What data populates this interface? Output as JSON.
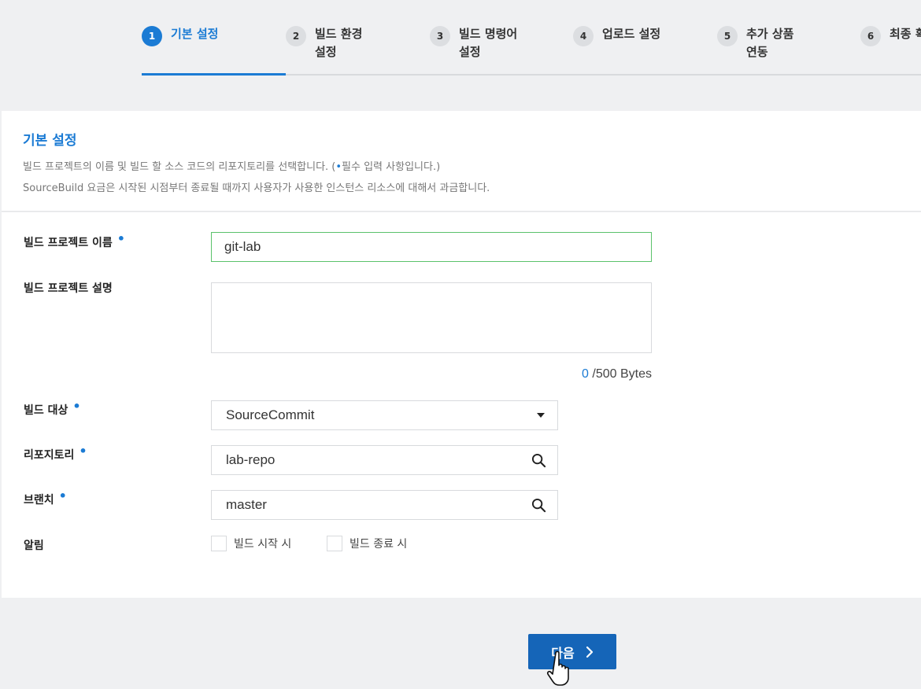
{
  "stepper": {
    "steps": [
      {
        "num": "1",
        "label": "기본 설정",
        "active": true
      },
      {
        "num": "2",
        "label": "빌드 환경\n설정",
        "active": false
      },
      {
        "num": "3",
        "label": "빌드 명령어\n설정",
        "active": false
      },
      {
        "num": "4",
        "label": "업로드 설정",
        "active": false
      },
      {
        "num": "5",
        "label": "추가 상품\n연동",
        "active": false
      },
      {
        "num": "6",
        "label": "최종 확",
        "active": false
      }
    ]
  },
  "header": {
    "title": "기본 설정",
    "desc1_prefix": "빌드 프로젝트의 이름 및 빌드 할 소스 코드의 리포지토리를 선택합니다. (",
    "desc1_dot": "•",
    "desc1_suffix": "필수 입력 사항입니다.)",
    "desc2": "SourceBuild 요금은 시작된 시점부터 종료될 때까지 사용자가 사용한 인스턴스 리소스에 대해서 과금합니다."
  },
  "form": {
    "required_mark": "•",
    "project_name": {
      "label": "빌드 프로젝트 이름",
      "value": "git-lab"
    },
    "project_desc": {
      "label": "빌드 프로젝트 설명",
      "value": "",
      "count": "0",
      "limit": " /500 Bytes"
    },
    "build_target": {
      "label": "빌드 대상",
      "value": "SourceCommit"
    },
    "repository": {
      "label": "리포지토리",
      "value": "lab-repo"
    },
    "branch": {
      "label": "브랜치",
      "value": "master"
    },
    "notify": {
      "label": "알림",
      "options": [
        "빌드 시작 시",
        "빌드 종료 시"
      ]
    }
  },
  "footer": {
    "next_label": "다음"
  },
  "colors": {
    "accent": "#1b7bd4",
    "button": "#1565b8",
    "focus": "#5bc26b"
  }
}
